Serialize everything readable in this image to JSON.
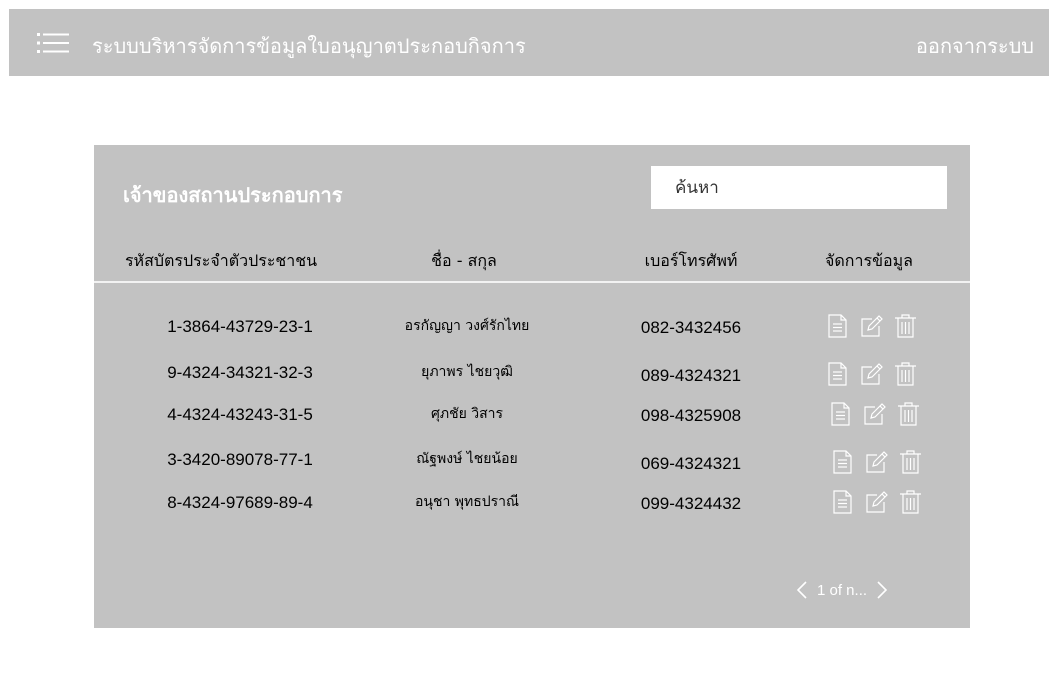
{
  "header": {
    "title": "ระบบบริหารจัดการข้อมูลใบอนุญาตประกอบกิจการ",
    "logout_label": "ออกจากระบบ",
    "menu_icon": "hamburger-menu-icon"
  },
  "panel": {
    "title": "เจ้าของสถานประกอบการ",
    "search_placeholder": "ค้นหา",
    "columns": [
      "รหัสบัตรประจำตัวประชาชน",
      "ชื่อ - สกุล",
      "เบอร์โทรศัพท์",
      "จัดการข้อมูล"
    ],
    "rows": [
      {
        "id": "1-3864-43729-23-1",
        "name": "อรกัญญา  วงศ์รักไทย",
        "phone": "082-3432456"
      },
      {
        "id": "9-4324-34321-32-3",
        "name": "ยุภาพร  ไชยวุฒิ",
        "phone": "089-4324321"
      },
      {
        "id": "4-4324-43243-31-5",
        "name": "ศุภชัย  วิสาร",
        "phone": "098-4325908"
      },
      {
        "id": "3-3420-89078-77-1",
        "name": "ณัฐพงษ์  ไชยน้อย",
        "phone": "069-4324321"
      },
      {
        "id": "8-4324-97689-89-4",
        "name": "อนุชา  พุทธปราณี",
        "phone": "099-4324432"
      }
    ],
    "row_action_icons": [
      "document-icon",
      "edit-icon",
      "trash-icon"
    ],
    "pagination": {
      "text": "1 of n...",
      "prev_icon": "chevron-left-icon",
      "next_icon": "chevron-right-icon"
    }
  },
  "colors": {
    "bar": "#c2c2c2",
    "panel": "#c2c2c2",
    "text_light": "#ffffff",
    "icon": "#ffffff"
  }
}
